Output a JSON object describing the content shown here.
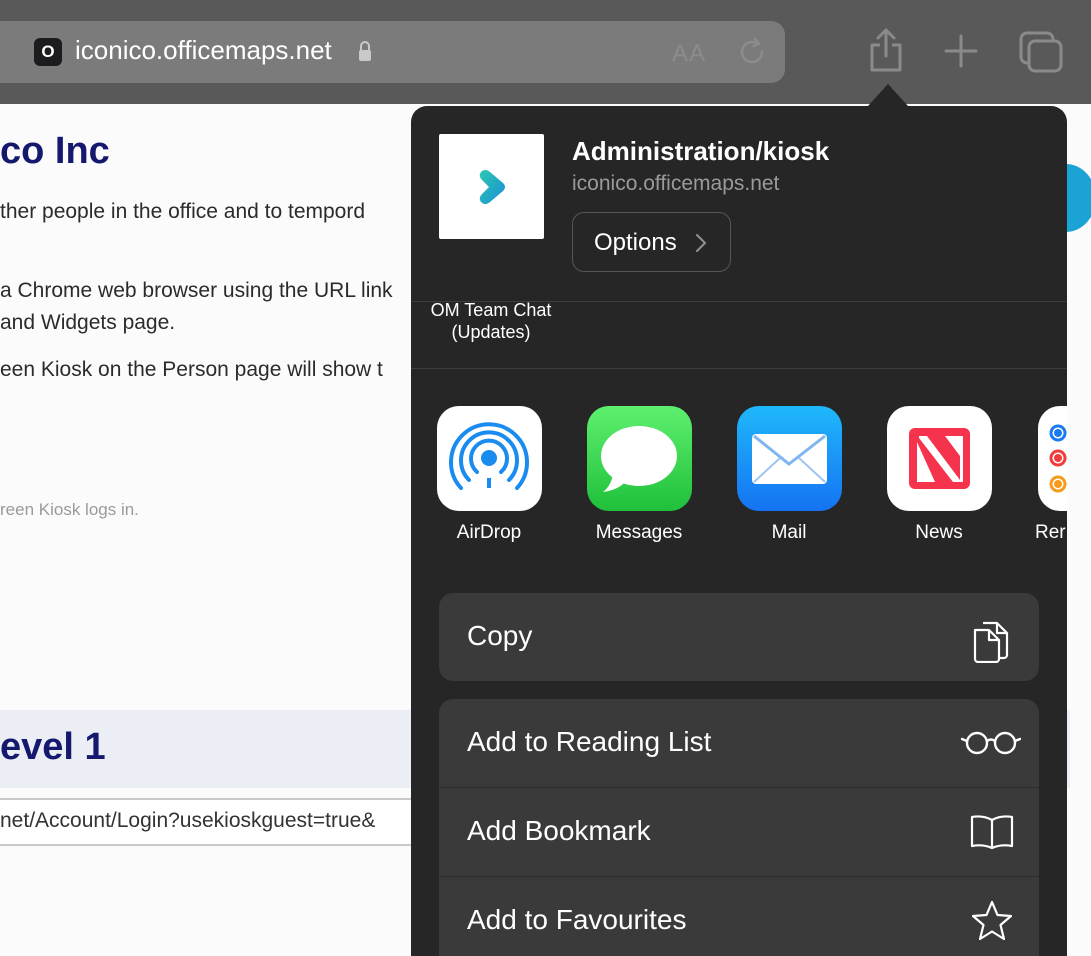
{
  "browser": {
    "favicon_letter": "O",
    "url": "iconico.officemaps.net",
    "reader_label": "AA"
  },
  "page": {
    "heading1": "co Inc",
    "para1": "ther people in the office and to tempord",
    "para2": "a Chrome web browser using the URL link",
    "para3": "and Widgets page.",
    "para4": "een Kiosk on the Person page will show t",
    "small_text": "reen Kiosk logs in.",
    "heading2": "evel 1",
    "url_input_value": "net/Account/Login?usekioskguest=true&"
  },
  "share_sheet": {
    "title": "Administration/kiosk",
    "subtitle": "iconico.officemaps.net",
    "options_label": "Options",
    "thumb_caption_line1": "OM Team Chat",
    "thumb_caption_line2": "(Updates)",
    "apps": [
      {
        "label": "AirDrop",
        "icon": "airdrop-icon"
      },
      {
        "label": "Messages",
        "icon": "messages-icon"
      },
      {
        "label": "Mail",
        "icon": "mail-icon"
      },
      {
        "label": "News",
        "icon": "news-icon"
      },
      {
        "label": "Rer",
        "icon": "reminders-icon"
      }
    ],
    "actions": [
      {
        "label": "Copy",
        "icon": "copy-icon"
      },
      {
        "label": "Add to Reading List",
        "icon": "glasses-icon"
      },
      {
        "label": "Add Bookmark",
        "icon": "book-icon"
      },
      {
        "label": "Add to Favourites",
        "icon": "star-icon"
      }
    ]
  },
  "colors": {
    "toolbar": "#595959",
    "sheet_background": "#262626",
    "action_row": "#3a3a3a",
    "heading_navy": "#14196e"
  }
}
